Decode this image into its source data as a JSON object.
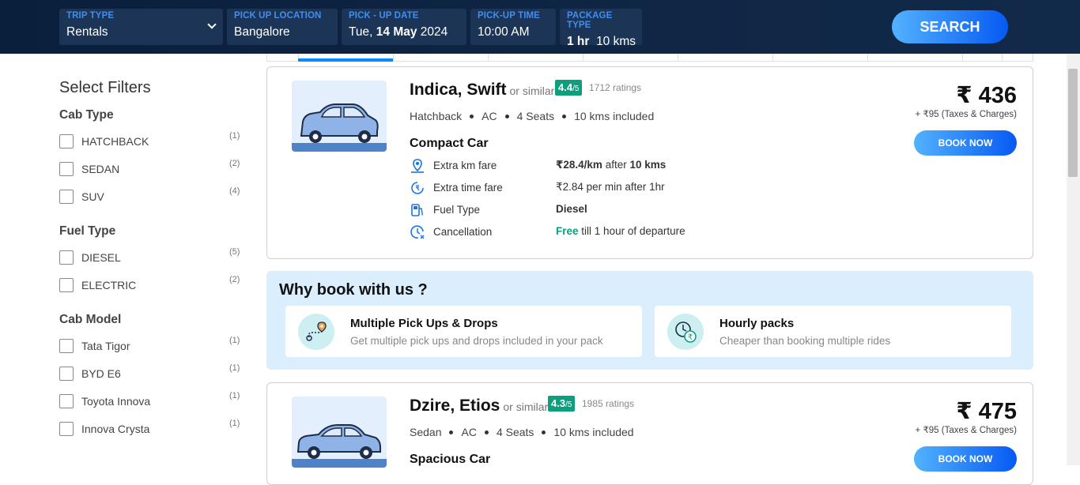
{
  "search": {
    "trip_type": {
      "label": "TRIP TYPE",
      "value": "Rentals"
    },
    "pickup_location": {
      "label": "PICK UP LOCATION",
      "value": "Bangalore"
    },
    "pickup_date": {
      "label": "PICK - UP DATE",
      "day": "Tue,",
      "date": "14 May",
      "year": "2024"
    },
    "pickup_time": {
      "label": "PICK-UP TIME",
      "value": "10:00 AM"
    },
    "package_type": {
      "label": "PACKAGE TYPE",
      "hours": "1 hr",
      "kms": "10 kms"
    },
    "search_label": "SEARCH"
  },
  "filters": {
    "title": "Select Filters",
    "cab_type": {
      "title": "Cab Type",
      "options": [
        {
          "label": "HATCHBACK",
          "count": "(1)"
        },
        {
          "label": "SEDAN",
          "count": "(2)"
        },
        {
          "label": "SUV",
          "count": "(4)"
        }
      ]
    },
    "fuel_type": {
      "title": "Fuel Type",
      "options": [
        {
          "label": "DIESEL",
          "count": "(5)"
        },
        {
          "label": "ELECTRIC",
          "count": "(2)"
        }
      ]
    },
    "cab_model": {
      "title": "Cab Model",
      "options": [
        {
          "label": "Tata Tigor",
          "count": "(1)"
        },
        {
          "label": "BYD E6",
          "count": "(1)"
        },
        {
          "label": "Toyota Innova",
          "count": "(1)"
        },
        {
          "label": "Innova Crysta",
          "count": "(1)"
        }
      ]
    }
  },
  "cars": [
    {
      "name": "Indica, Swift",
      "similar": "or similar",
      "rating": "4.4",
      "rating_suffix": "/5",
      "ratings_count": "1712 ratings",
      "specs": [
        "Hatchback",
        "AC",
        "4 Seats",
        "10 kms included"
      ],
      "class": "Compact Car",
      "extra_km_label": "Extra km fare",
      "extra_km_value": "₹28.4/km",
      "extra_km_after": "after",
      "extra_km_kms": "10 kms",
      "extra_time_label": "Extra time fare",
      "extra_time_value": "₹2.84 per min after 1hr",
      "fuel_label": "Fuel Type",
      "fuel_value": "Diesel",
      "cancel_label": "Cancellation",
      "cancel_free": "Free",
      "cancel_rest": "till 1 hour of departure",
      "price": "₹ 436",
      "taxes": "+ ₹95 (Taxes & Charges)",
      "book_label": "BOOK NOW"
    },
    {
      "name": "Dzire, Etios",
      "similar": "or similar",
      "rating": "4.3",
      "rating_suffix": "/5",
      "ratings_count": "1985 ratings",
      "specs": [
        "Sedan",
        "AC",
        "4 Seats",
        "10 kms included"
      ],
      "class": "Spacious Car",
      "price": "₹ 475",
      "taxes": "+ ₹95 (Taxes & Charges)",
      "book_label": "BOOK NOW"
    }
  ],
  "why": {
    "title": "Why book with us ?",
    "items": [
      {
        "title": "Multiple Pick Ups & Drops",
        "subtitle": "Get multiple pick ups and drops included in your pack"
      },
      {
        "title": "Hourly packs",
        "subtitle": "Cheaper than booking multiple rides"
      }
    ]
  },
  "colors": {
    "accent": "#008cff",
    "header": "#0a1f3c",
    "rating": "#0b9f7e"
  }
}
